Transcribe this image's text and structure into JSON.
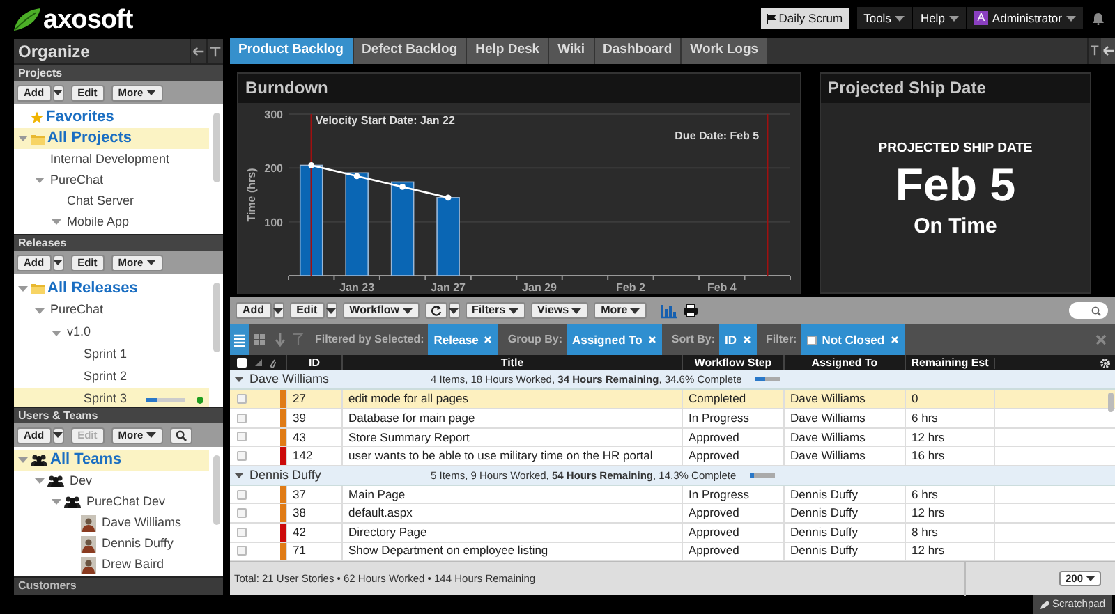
{
  "logo": {
    "text": "axosoft"
  },
  "sidebar": {
    "title": "Organize",
    "sections": [
      {
        "title": "Projects",
        "expanded": true,
        "toolbar": [
          {
            "label": "Add",
            "kind": "split",
            "disabled": false
          },
          {
            "label": "Edit",
            "kind": "plain",
            "disabled": false
          },
          {
            "label": "More",
            "kind": "menu",
            "disabled": false
          }
        ],
        "tree": [
          {
            "label": "Favorites",
            "kind": "favorites",
            "selected": false
          },
          {
            "label": "All Projects",
            "kind": "folder",
            "expanded": true,
            "selected": true,
            "children": [
              {
                "label": "Internal Development",
                "kind": "node",
                "selected": false
              },
              {
                "label": "PureChat",
                "kind": "node",
                "expanded": true,
                "selected": false,
                "children": [
                  {
                    "label": "Chat Server",
                    "kind": "node",
                    "selected": false
                  },
                  {
                    "label": "Mobile App",
                    "kind": "node",
                    "expanded": true,
                    "selected": false
                  }
                ]
              }
            ]
          }
        ]
      },
      {
        "title": "Releases",
        "expanded": true,
        "toolbar": [
          {
            "label": "Add",
            "kind": "split",
            "disabled": false
          },
          {
            "label": "Edit",
            "kind": "plain",
            "disabled": false
          },
          {
            "label": "More",
            "kind": "menu",
            "disabled": false
          }
        ],
        "tree": [
          {
            "label": "All Releases",
            "kind": "folder",
            "expanded": true,
            "selected": false,
            "children": [
              {
                "label": "PureChat",
                "kind": "node",
                "expanded": true,
                "selected": false,
                "children": [
                  {
                    "label": "v1.0",
                    "kind": "node",
                    "expanded": true,
                    "selected": false,
                    "children": [
                      {
                        "label": "Sprint 1",
                        "kind": "node",
                        "selected": false
                      },
                      {
                        "label": "Sprint 2",
                        "kind": "node",
                        "selected": false
                      },
                      {
                        "label": "Sprint 3",
                        "kind": "node",
                        "selected": true,
                        "level": 0.3,
                        "color": "#1f9e1f"
                      }
                    ]
                  }
                ]
              }
            ]
          }
        ]
      },
      {
        "title": "Users & Teams",
        "expanded": true,
        "toolbar": [
          {
            "label": "Add",
            "kind": "split",
            "disabled": false
          },
          {
            "label": "Edit",
            "kind": "plain",
            "disabled": true
          },
          {
            "label": "More",
            "kind": "menu",
            "disabled": false
          },
          {
            "kind": "search",
            "disabled": false
          }
        ],
        "tree": [
          {
            "label": "All Teams",
            "kind": "all-teams",
            "expanded": true,
            "selected": true,
            "children": [
              {
                "label": "Dev",
                "kind": "team",
                "expanded": true,
                "selected": false,
                "children": [
                  {
                    "label": "PureChat Dev",
                    "kind": "team",
                    "expanded": true,
                    "selected": false,
                    "children": [
                      {
                        "label": "Dave Williams",
                        "kind": "person",
                        "selected": false
                      },
                      {
                        "label": "Dennis Duffy",
                        "kind": "person",
                        "selected": false
                      },
                      {
                        "label": "Drew Baird",
                        "kind": "person",
                        "selected": false
                      }
                    ]
                  }
                ]
              }
            ]
          }
        ]
      },
      {
        "title": "Customers",
        "expanded": false
      }
    ]
  },
  "top_bar": {
    "daily_scrum": "Daily Scrum",
    "menus": [
      {
        "label": "Tools"
      },
      {
        "label": "Help"
      },
      {
        "label": "Administrator",
        "avatar": "A"
      }
    ]
  },
  "tabs": [
    {
      "label": "Product Backlog",
      "selected": true
    },
    {
      "label": "Defect Backlog",
      "selected": false
    },
    {
      "label": "Help Desk",
      "selected": false
    },
    {
      "label": "Wiki",
      "selected": false
    },
    {
      "label": "Dashboard",
      "selected": false
    },
    {
      "label": "Work Logs",
      "selected": false
    }
  ],
  "burndown": {
    "title": "Burndown",
    "chart_data": {
      "type": "bar",
      "ylabel": "Time (hrs)",
      "stacked": false,
      "categories": [
        null,
        "Jan 23",
        null,
        "Jan 27",
        null,
        "Jan 29",
        null,
        "Feb 2",
        null,
        "Feb 4",
        null
      ],
      "ylim": [
        0,
        300
      ],
      "yticks": [
        100,
        200,
        300
      ],
      "grid": true,
      "series": [
        {
          "color": "#0a66b4",
          "values": [
            205,
            191,
            174,
            145,
            null,
            null,
            null,
            null,
            null,
            null,
            null
          ]
        },
        {
          "type": "line",
          "marker": true,
          "color": "#ffffff",
          "values": [
            205,
            185,
            165,
            145,
            null,
            null,
            null,
            null,
            null,
            null,
            null
          ]
        }
      ],
      "annotations": [
        "Velocity Start Date: Jan 22",
        "Due Date: Feb 5"
      ]
    }
  },
  "ship_date": {
    "title": "Projected Ship Date",
    "heading": "PROJECTED SHIP DATE",
    "date": "Feb 5",
    "status": "On Time"
  },
  "grid_toolbar": [
    {
      "label": "Add",
      "kind": "split"
    },
    {
      "label": "Edit",
      "kind": "split"
    },
    {
      "label": "Workflow",
      "kind": "menu"
    },
    {
      "kind": "refresh"
    },
    {
      "label": "Filters",
      "kind": "menu"
    },
    {
      "label": "Views",
      "kind": "menu"
    },
    {
      "label": "More",
      "kind": "menu"
    },
    {
      "kind": "chart"
    },
    {
      "kind": "print"
    }
  ],
  "view_modes": [
    {
      "kind": "list",
      "selected": true
    },
    {
      "kind": "cards",
      "selected": false
    }
  ],
  "filters": [
    {
      "label": "Filtered by Selected:",
      "chip": "Release"
    },
    {
      "label": "Group By:",
      "chip": "Assigned To"
    },
    {
      "label": "Sort By:",
      "chip": "ID"
    },
    {
      "label": "Filter:",
      "chip": "Not Closed",
      "checked": false
    }
  ],
  "table": {
    "select_all_checked": false,
    "columns": [
      "ID",
      "Title",
      "Workflow Step",
      "Assigned To",
      "Remaining Est"
    ],
    "groups": [
      {
        "name": "Dave Williams",
        "expanded": true,
        "summary": "4 Items, 18 Hours Worked, **34 Hours Remaining**, 34.6% Complete",
        "level": 0.346,
        "rows": [
          {
            "id": "27",
            "title": "edit mode for all pages",
            "workflow_step": "Completed",
            "assigned_to": "Dave Williams",
            "remaining": "0",
            "color": "#e07b16",
            "selected": true,
            "checked": false
          },
          {
            "id": "39",
            "title": "Database for main page",
            "workflow_step": "In Progress",
            "assigned_to": "Dave Williams",
            "remaining": "6 hrs",
            "color": "#e07b16",
            "selected": false,
            "checked": false
          },
          {
            "id": "43",
            "title": "Store Summary Report",
            "workflow_step": "Approved",
            "assigned_to": "Dave Williams",
            "remaining": "12 hrs",
            "color": "#e07b16",
            "selected": false,
            "checked": false
          },
          {
            "id": "142",
            "title": "user wants to be able to use military time on the HR portal",
            "workflow_step": "Approved",
            "assigned_to": "Dave Williams",
            "remaining": "16 hrs",
            "color": "#cc0a0a",
            "selected": false,
            "checked": false
          }
        ]
      },
      {
        "name": "Dennis Duffy",
        "expanded": true,
        "summary": "5 Items, 9 Hours Worked, **54 Hours Remaining**, 14.3% Complete",
        "level": 0.143,
        "rows": [
          {
            "id": "37",
            "title": "Main Page",
            "workflow_step": "In Progress",
            "assigned_to": "Dennis Duffy",
            "remaining": "6 hrs",
            "color": "#e07b16",
            "selected": false,
            "checked": false
          },
          {
            "id": "38",
            "title": "default.aspx",
            "workflow_step": "Approved",
            "assigned_to": "Dennis Duffy",
            "remaining": "12 hrs",
            "color": "#e07b16",
            "selected": false,
            "checked": false
          },
          {
            "id": "42",
            "title": "Directory Page",
            "workflow_step": "Approved",
            "assigned_to": "Dennis Duffy",
            "remaining": "8 hrs",
            "color": "#cc0a0a",
            "selected": false,
            "checked": false
          },
          {
            "id": "71",
            "title": "Show Department on employee listing",
            "workflow_step": "Approved",
            "assigned_to": "Dennis Duffy",
            "remaining": "12 hrs",
            "color": "#e07b16",
            "selected": false,
            "checked": false
          }
        ]
      }
    ]
  },
  "footer": {
    "summary": "Total: 21 User Stories • 62 Hours Worked • 144 Hours Remaining",
    "page_size": "200"
  },
  "scratchpad": "Scratchpad"
}
